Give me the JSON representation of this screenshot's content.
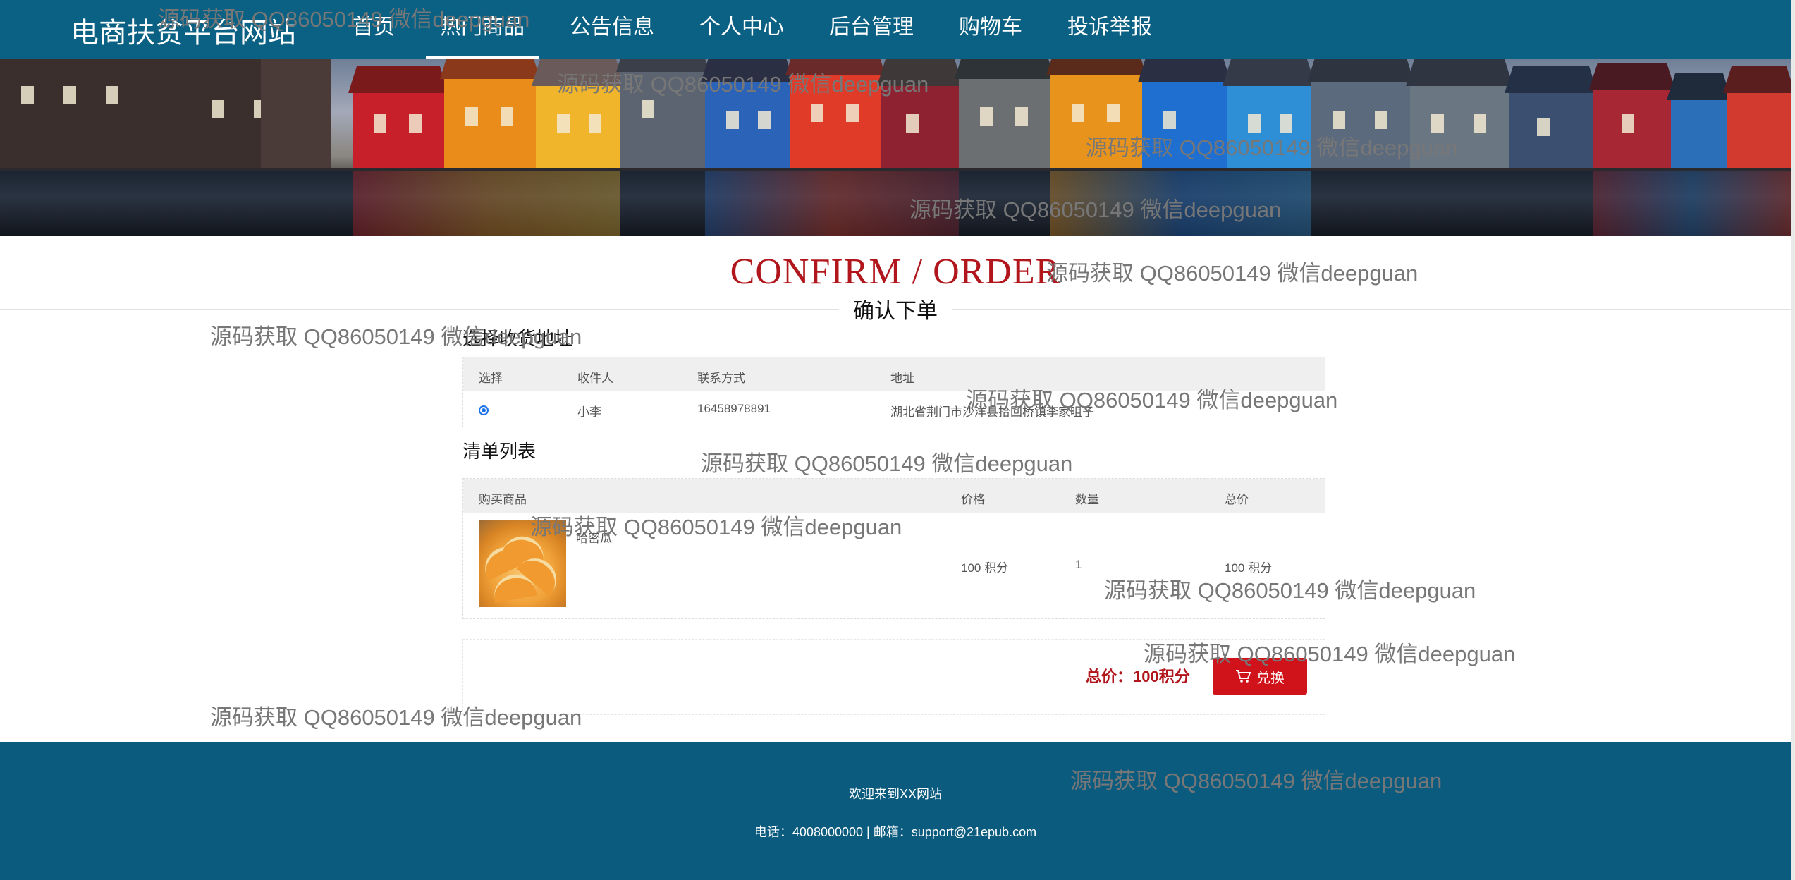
{
  "nav": {
    "brand": "电商扶贫平台网站",
    "items": [
      {
        "label": "首页"
      },
      {
        "label": "热门商品",
        "active": true
      },
      {
        "label": "公告信息"
      },
      {
        "label": "个人中心"
      },
      {
        "label": "后台管理"
      },
      {
        "label": "购物车"
      },
      {
        "label": "投诉举报"
      }
    ]
  },
  "heading": {
    "title": "CONFIRM / ORDER",
    "subtitle": "确认下单"
  },
  "address": {
    "title": "选择收货地址",
    "columns": [
      "选择",
      "收件人",
      "联系方式",
      "地址"
    ],
    "row": {
      "selected": true,
      "name": "小李",
      "phone": "16458978891",
      "address": "湖北省荆门市沙洋县拾回桥镇李家咀子"
    }
  },
  "list": {
    "title": "清单列表",
    "columns": [
      "购买商品",
      "价格",
      "数量",
      "总价"
    ],
    "item": {
      "name": "哈密瓜",
      "price": "100 积分",
      "qty": "1",
      "total": "100 积分"
    }
  },
  "summary": {
    "label": "总价：",
    "value": "100积分",
    "button": "兑换"
  },
  "footer": {
    "line1": "欢迎来到XX网站",
    "line2": "电话：4008000000 | 邮箱：support@21epub.com"
  },
  "watermark": "源码获取 QQ86050149 微信deepguan",
  "colors": {
    "nav": "#0b6183",
    "accent": "#b0161b",
    "button": "#d0121b",
    "footer": "#0b5b7f"
  }
}
